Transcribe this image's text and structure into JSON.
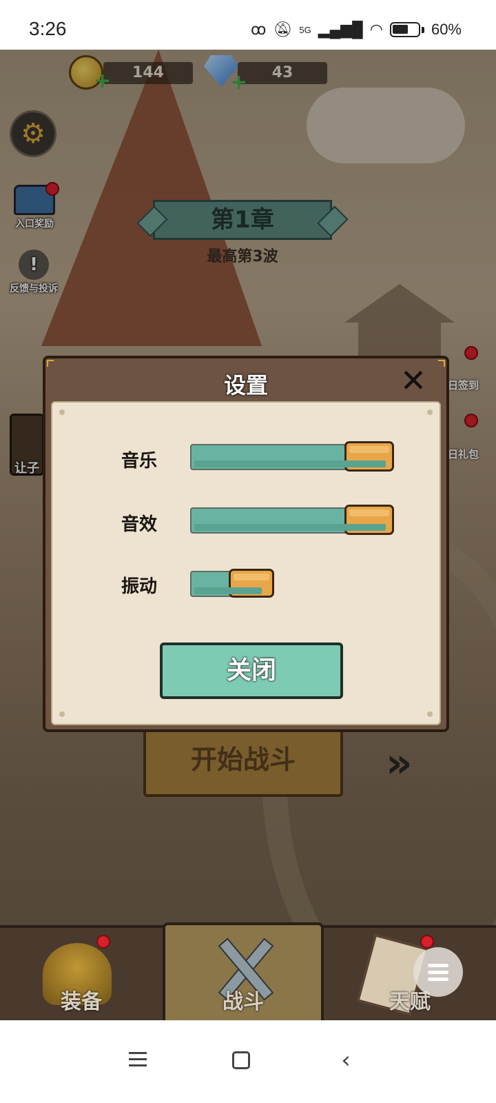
{
  "status_bar": {
    "time": "3:26",
    "network": "5G",
    "battery": "60%"
  },
  "currency": {
    "gold": "144",
    "diamonds": "43"
  },
  "side_left": {
    "entry_reward_label": "入口奖励",
    "feedback_label": "反馈与投诉",
    "partial_label": "让子"
  },
  "side_right": {
    "signin_label": "日签到",
    "gift_label": "日礼包"
  },
  "chapter": {
    "title": "第1章",
    "best_wave": "最高第3波"
  },
  "start_battle_label": "开始战斗",
  "settings_dialog": {
    "title": "设置",
    "music_label": "音乐",
    "sfx_label": "音效",
    "vibration_label": "振动",
    "music_level": 1.0,
    "sfx_level": 1.0,
    "vibration_on": true,
    "close_label": "关闭"
  },
  "bottom_nav": {
    "equipment": "装备",
    "battle": "战斗",
    "talent": "天赋"
  },
  "icons": {
    "settings": "gear-icon",
    "currency_gold": "coin-icon",
    "currency_gem": "diamond-icon",
    "close": "close-icon",
    "menu": "menu-icon"
  }
}
